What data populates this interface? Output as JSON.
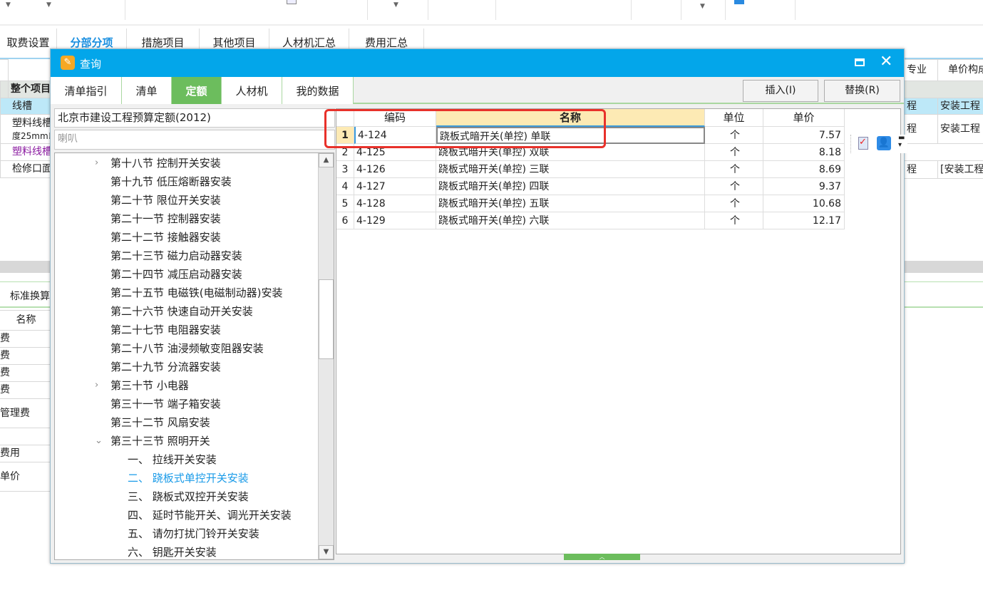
{
  "background": {
    "main_tabs": [
      "取费设置",
      "分部分项",
      "措施项目",
      "其他项目",
      "人材机汇总",
      "费用汇总"
    ],
    "active_main_tab": "分部分项",
    "table_left": [
      "整个项目",
      "线槽",
      "塑料线槽",
      "度25mm以",
      "塑料线槽",
      "检修口面"
    ],
    "table_right_headers": [
      "专业",
      "单价构成"
    ],
    "table_right_values": [
      "程",
      "安装工程",
      "程",
      "安装工程",
      "程",
      "[安装工程"
    ],
    "lower_tab": "标准换算",
    "lower_header": "名称",
    "lower_rows": [
      "费",
      "费",
      "费",
      "费",
      "管理费",
      "",
      "费用",
      "单价"
    ]
  },
  "dialog": {
    "title": "查询",
    "tabs": [
      "清单指引",
      "清单",
      "定额",
      "人材机",
      "我的数据"
    ],
    "active_tab": "定额",
    "insert_button": "插入(I)",
    "replace_button": "替换(R)",
    "quota_library": "北京市建设工程预算定额(2012)",
    "search_value": "喇叭",
    "tree": [
      {
        "label": "第十八节 控制开关安装",
        "level": 1,
        "expander": "collapsed"
      },
      {
        "label": "第十九节 低压熔断器安装",
        "level": 1
      },
      {
        "label": "第二十节 限位开关安装",
        "level": 1
      },
      {
        "label": "第二十一节 控制器安装",
        "level": 1
      },
      {
        "label": "第二十二节 接触器安装",
        "level": 1
      },
      {
        "label": "第二十三节 磁力启动器安装",
        "level": 1
      },
      {
        "label": "第二十四节 减压启动器安装",
        "level": 1
      },
      {
        "label": "第二十五节 电磁铁(电磁制动器)安装",
        "level": 1
      },
      {
        "label": "第二十六节 快速自动开关安装",
        "level": 1
      },
      {
        "label": "第二十七节 电阻器安装",
        "level": 1
      },
      {
        "label": "第二十八节 油浸频敏变阻器安装",
        "level": 1
      },
      {
        "label": "第二十九节 分流器安装",
        "level": 1
      },
      {
        "label": "第三十节 小电器",
        "level": 1,
        "expander": "collapsed"
      },
      {
        "label": "第三十一节 端子箱安装",
        "level": 1
      },
      {
        "label": "第三十二节 风扇安装",
        "level": 1
      },
      {
        "label": "第三十三节 照明开关",
        "level": 1,
        "expander": "expanded"
      },
      {
        "label": "一、 拉线开关安装",
        "level": 2
      },
      {
        "label": "二、 跷板式单控开关安装",
        "level": 2,
        "selected": true
      },
      {
        "label": "三、 跷板式双控开关安装",
        "level": 2
      },
      {
        "label": "四、 延时节能开关、调光开关安装",
        "level": 2
      },
      {
        "label": "五、 请勿打扰门铃开关安装",
        "level": 2
      },
      {
        "label": "六、 钥匙开关安装",
        "level": 2
      }
    ],
    "grid": {
      "headers": [
        "",
        "编码",
        "名称",
        "单位",
        "单价"
      ],
      "rows": [
        [
          "1",
          "4-124",
          "跷板式暗开关(单控) 单联",
          "个",
          "7.57"
        ],
        [
          "2",
          "4-125",
          "跷板式暗开关(单控) 双联",
          "个",
          "8.18"
        ],
        [
          "3",
          "4-126",
          "跷板式暗开关(单控) 三联",
          "个",
          "8.69"
        ],
        [
          "4",
          "4-127",
          "跷板式暗开关(单控) 四联",
          "个",
          "9.37"
        ],
        [
          "5",
          "4-128",
          "跷板式暗开关(单控) 五联",
          "个",
          "10.68"
        ],
        [
          "6",
          "4-129",
          "跷板式暗开关(单控) 六联",
          "个",
          "12.17"
        ]
      ]
    }
  },
  "colors": {
    "title_bar": "#03a6ea",
    "active_tab": "#6cbd5d",
    "highlight_box": "#e8312a",
    "selected_tree": "#1a9be8"
  }
}
